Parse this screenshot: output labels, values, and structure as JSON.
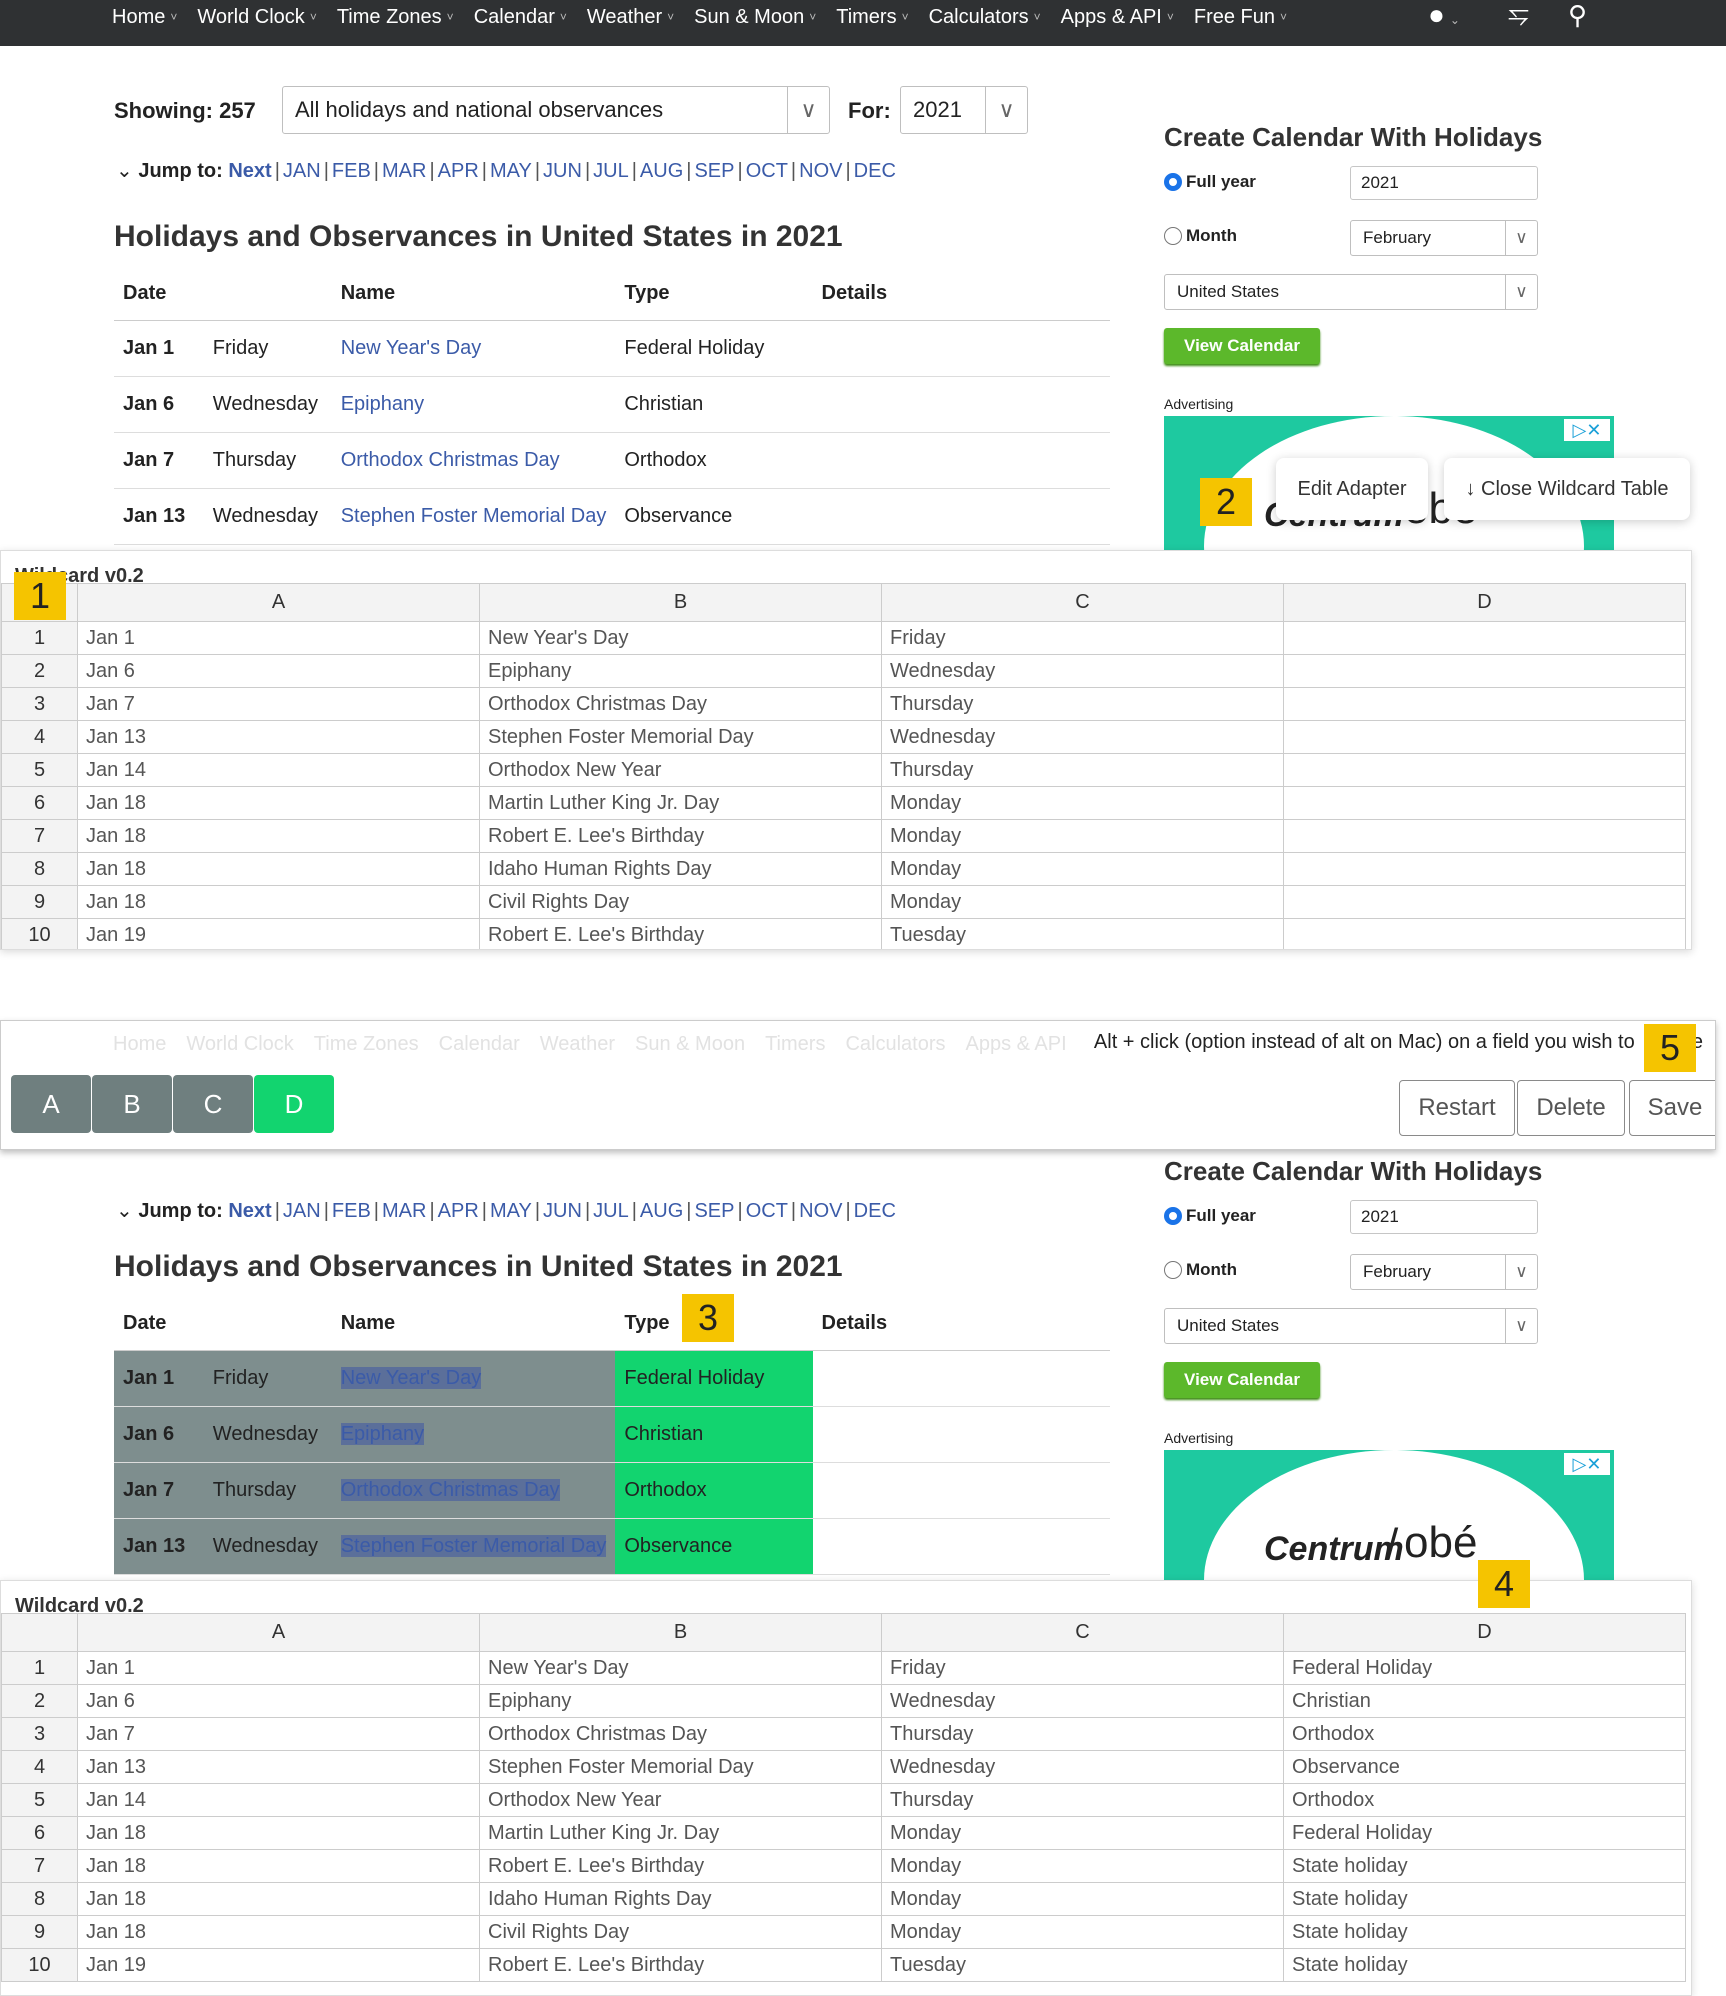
{
  "nav": {
    "items": [
      "Home",
      "World Clock",
      "Time Zones",
      "Calendar",
      "Weather",
      "Sun & Moon",
      "Timers",
      "Calculators",
      "Apps & API",
      "Free Fun"
    ],
    "icons": [
      "user-icon",
      "share-icon",
      "search-icon"
    ]
  },
  "filter": {
    "showing_label": "Showing: 257",
    "select_value": "All holidays and national observances",
    "for_label": "For:",
    "year": "2021"
  },
  "jump": {
    "label": "Jump to:",
    "next": "Next",
    "months": [
      "JAN",
      "FEB",
      "MAR",
      "APR",
      "MAY",
      "JUN",
      "JUL",
      "AUG",
      "SEP",
      "OCT",
      "NOV",
      "DEC"
    ]
  },
  "heading": "Holidays and Observances in United States in 2021",
  "holiday_table": {
    "headers": [
      "Date",
      "Name",
      "Type",
      "Details"
    ],
    "rows": [
      {
        "date": "Jan 1",
        "weekday": "Friday",
        "name": "New Year's Day",
        "type": "Federal Holiday"
      },
      {
        "date": "Jan 6",
        "weekday": "Wednesday",
        "name": "Epiphany",
        "type": "Christian"
      },
      {
        "date": "Jan 7",
        "weekday": "Thursday",
        "name": "Orthodox Christmas Day",
        "type": "Orthodox"
      },
      {
        "date": "Jan 13",
        "weekday": "Wednesday",
        "name": "Stephen Foster Memorial Day",
        "type": "Observance"
      }
    ]
  },
  "sidebar": {
    "title": "Create Calendar With Holidays",
    "full_year_label": "Full year",
    "full_year_value": "2021",
    "month_label": "Month",
    "month_value": "February",
    "country_value": "United States",
    "view_button": "View Calendar",
    "advertising_label": "Advertising",
    "ad_brand": "Centrum",
    "ad_partner": "obé"
  },
  "popups": {
    "edit_adapter": "Edit Adapter",
    "close_table": "↓ Close Wildcard Table"
  },
  "markers": [
    "1",
    "2",
    "3",
    "4",
    "5"
  ],
  "wildcard": {
    "title": "Wildcard v0.2",
    "columns": [
      "A",
      "B",
      "C",
      "D"
    ],
    "rows_top": [
      [
        "1",
        "Jan 1",
        "New Year's Day",
        "Friday",
        ""
      ],
      [
        "2",
        "Jan 6",
        "Epiphany",
        "Wednesday",
        ""
      ],
      [
        "3",
        "Jan 7",
        "Orthodox Christmas Day",
        "Thursday",
        ""
      ],
      [
        "4",
        "Jan 13",
        "Stephen Foster Memorial Day",
        "Wednesday",
        ""
      ],
      [
        "5",
        "Jan 14",
        "Orthodox New Year",
        "Thursday",
        ""
      ],
      [
        "6",
        "Jan 18",
        "Martin Luther King Jr. Day",
        "Monday",
        ""
      ],
      [
        "7",
        "Jan 18",
        "Robert E. Lee's Birthday",
        "Monday",
        ""
      ],
      [
        "8",
        "Jan 18",
        "Idaho Human Rights Day",
        "Monday",
        ""
      ],
      [
        "9",
        "Jan 18",
        "Civil Rights Day",
        "Monday",
        ""
      ],
      [
        "10",
        "Jan 19",
        "Robert E. Lee's Birthday",
        "Tuesday",
        ""
      ]
    ],
    "rows_bottom": [
      [
        "1",
        "Jan 1",
        "New Year's Day",
        "Friday",
        "Federal Holiday"
      ],
      [
        "2",
        "Jan 6",
        "Epiphany",
        "Wednesday",
        "Christian"
      ],
      [
        "3",
        "Jan 7",
        "Orthodox Christmas Day",
        "Thursday",
        "Orthodox"
      ],
      [
        "4",
        "Jan 13",
        "Stephen Foster Memorial Day",
        "Wednesday",
        "Observance"
      ],
      [
        "5",
        "Jan 14",
        "Orthodox New Year",
        "Thursday",
        "Orthodox"
      ],
      [
        "6",
        "Jan 18",
        "Martin Luther King Jr. Day",
        "Monday",
        "Federal Holiday"
      ],
      [
        "7",
        "Jan 18",
        "Robert E. Lee's Birthday",
        "Monday",
        "State holiday"
      ],
      [
        "8",
        "Jan 18",
        "Idaho Human Rights Day",
        "Monday",
        "State holiday"
      ],
      [
        "9",
        "Jan 18",
        "Civil Rights Day",
        "Monday",
        "State holiday"
      ],
      [
        "10",
        "Jan 19",
        "Robert E. Lee's Birthday",
        "Tuesday",
        "State holiday"
      ]
    ]
  },
  "toolbar": {
    "hint": "Alt + click (option instead of alt on Mac) on a field you wish to",
    "hint_tail": "be",
    "column_buttons": [
      "A",
      "B",
      "C",
      "D"
    ],
    "active_column": "D",
    "restart": "Restart",
    "delete": "Delete",
    "save": "Save"
  },
  "colors": {
    "nav_bg": "#2f3133",
    "link": "#3b5ba8",
    "view_button": "#5cb82b",
    "marker": "#f5c400",
    "active_column": "#12d46f",
    "inactive_column": "#6f7f7f"
  }
}
